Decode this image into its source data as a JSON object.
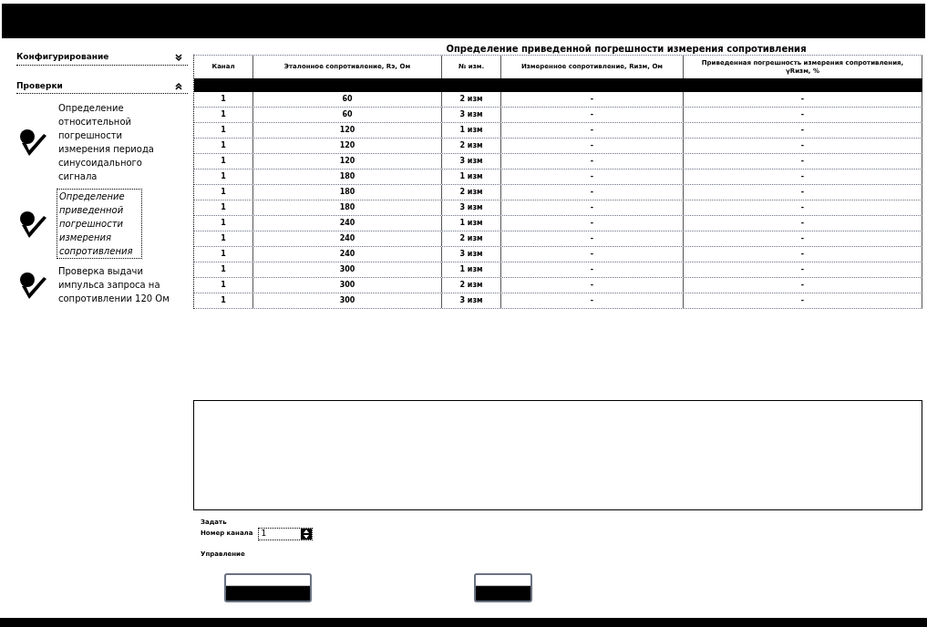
{
  "sidebar": {
    "sections": [
      {
        "title": "Конфигурирование",
        "expanded": false
      },
      {
        "title": "Проверки",
        "expanded": true
      }
    ],
    "items": [
      {
        "label": "Определение относительной погрешности измерения периода синусоидального сигнала",
        "selected": false
      },
      {
        "label": "Определение приведенной погрешности измерения сопротивления",
        "selected": true
      },
      {
        "label": "Проверка выдачи импульса запроса на сопротивлении 120 Ом",
        "selected": false
      }
    ]
  },
  "table": {
    "title": "Определение приведенной погрешности измерения сопротивления",
    "columns": [
      "Канал",
      "Эталонное сопротивление, Rэ, Ом",
      "№ изм.",
      "Измеренное сопротивление, Rизм, Ом",
      "Приведенная погрешность измерения сопротивления, γRизм, %"
    ],
    "rows": [
      [
        "1",
        "60",
        "2 изм",
        "-",
        "-"
      ],
      [
        "1",
        "60",
        "3 изм",
        "-",
        "-"
      ],
      [
        "1",
        "120",
        "1 изм",
        "-",
        "-"
      ],
      [
        "1",
        "120",
        "2 изм",
        "-",
        "-"
      ],
      [
        "1",
        "120",
        "3 изм",
        "-",
        "-"
      ],
      [
        "1",
        "180",
        "1 изм",
        "-",
        "-"
      ],
      [
        "1",
        "180",
        "2 изм",
        "-",
        "-"
      ],
      [
        "1",
        "180",
        "3 изм",
        "-",
        "-"
      ],
      [
        "1",
        "240",
        "1 изм",
        "-",
        "-"
      ],
      [
        "1",
        "240",
        "2 изм",
        "-",
        "-"
      ],
      [
        "1",
        "240",
        "3 изм",
        "-",
        "-"
      ],
      [
        "1",
        "300",
        "1 изм",
        "-",
        "-"
      ],
      [
        "1",
        "300",
        "2 изм",
        "-",
        "-"
      ],
      [
        "1",
        "300",
        "3 изм",
        "-",
        "-"
      ]
    ]
  },
  "controls": {
    "group_label": "Задать",
    "channel_label": "Номер канала",
    "channel_value": "1",
    "management_label": "Управление"
  }
}
